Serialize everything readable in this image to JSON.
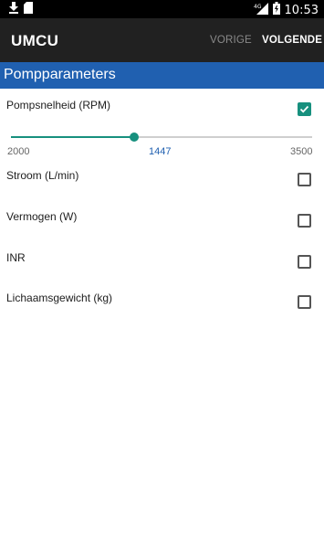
{
  "status_bar": {
    "time": "10:53",
    "network": "4G",
    "icons": [
      "download-icon",
      "sd-card-icon",
      "signal-icon",
      "battery-icon"
    ]
  },
  "app_bar": {
    "title": "UMCU",
    "prev_label": "VORIGE",
    "next_label": "VOLGENDE"
  },
  "section": {
    "title": "Pompparameters"
  },
  "params": [
    {
      "label": "Pompsnelheid (RPM)",
      "checked": true
    },
    {
      "label": "Stroom (L/min)",
      "checked": false
    },
    {
      "label": "Vermogen (W)",
      "checked": false
    },
    {
      "label": "INR",
      "checked": false
    },
    {
      "label": "Lichaamsgewicht (kg)",
      "checked": false
    }
  ],
  "slider": {
    "min": "2000",
    "value": "1447",
    "max": "3500",
    "fill_fraction": 0.41
  },
  "colors": {
    "accent": "#17907e",
    "header_blue": "#2060b0",
    "app_bar": "#212121"
  }
}
